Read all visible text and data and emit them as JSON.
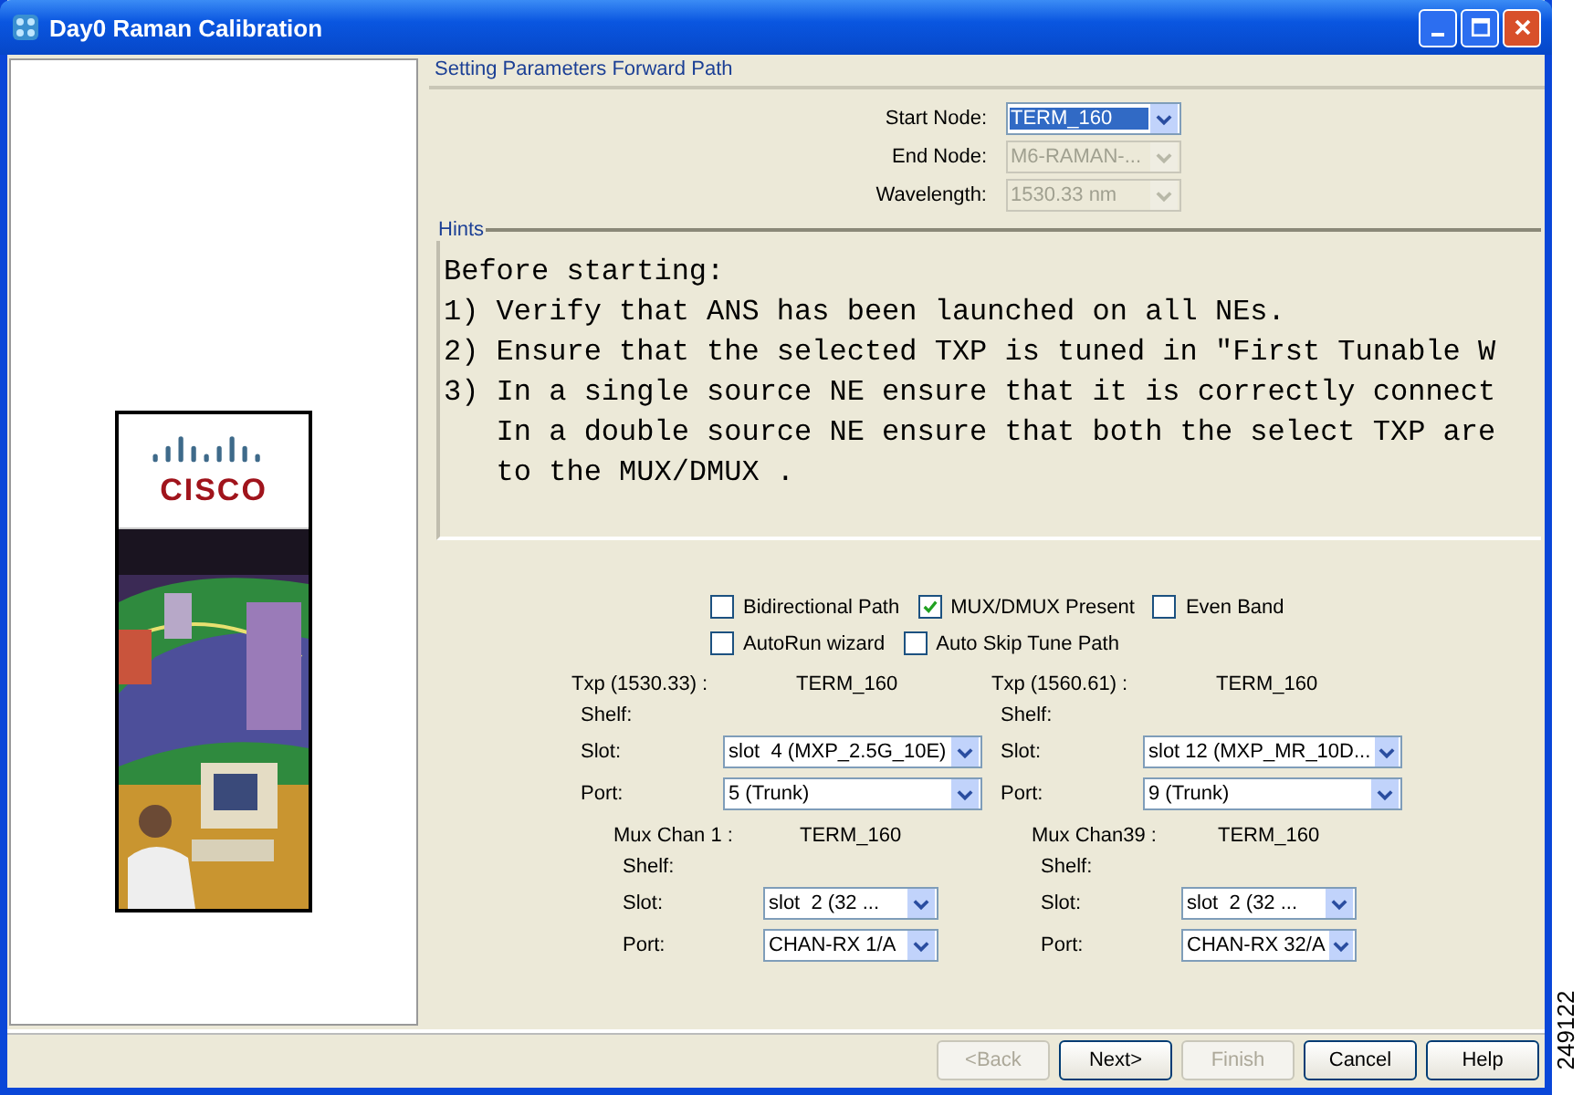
{
  "window": {
    "title": "Day0 Raman Calibration"
  },
  "logo": {
    "text": "CISCO"
  },
  "section_title": "Setting Parameters Forward Path",
  "node_fields": [
    {
      "label": "Start Node:",
      "value": "TERM_160",
      "disabled": false,
      "focused": true
    },
    {
      "label": "End Node:",
      "value": "M6-RAMAN-...",
      "disabled": true,
      "focused": false
    },
    {
      "label": "Wavelength:",
      "value": "1530.33 nm",
      "disabled": true,
      "focused": false
    }
  ],
  "hints": {
    "title": "Hints",
    "lines": [
      "Before starting:",
      "1) Verify that ANS has been launched on all NEs.",
      "2) Ensure that the selected TXP is tuned in \"First Tunable W",
      "3) In a single source NE ensure that it is correctly connect",
      "   In a double source NE ensure that both the select TXP are",
      "   to the MUX/DMUX ."
    ]
  },
  "option_rows": [
    [
      {
        "label": "Bidirectional Path",
        "checked": false
      },
      {
        "label": "MUX/DMUX Present",
        "checked": true
      },
      {
        "label": "Even Band",
        "checked": false
      }
    ],
    [
      {
        "label": "AutoRun wizard",
        "checked": false
      },
      {
        "label": "Auto Skip Tune Path",
        "checked": false
      }
    ]
  ],
  "transponders": [
    {
      "label": "Txp (1530.33) :",
      "node": "TERM_160",
      "shelf_label": "Shelf:",
      "slot_label": "Slot:",
      "slot": "slot  4 (MXP_2.5G_10E)",
      "port_label": "Port:",
      "port": "5 (Trunk)"
    },
    {
      "label": "Txp (1560.61) :",
      "node": "TERM_160",
      "shelf_label": "Shelf:",
      "slot_label": "Slot:",
      "slot": "slot 12 (MXP_MR_10D...",
      "port_label": "Port:",
      "port": "9 (Trunk)"
    }
  ],
  "mux_channels": [
    {
      "label": "Mux Chan 1 :",
      "node": "TERM_160",
      "shelf_label": "Shelf:",
      "slot_label": "Slot:",
      "slot": "slot  2 (32 ...",
      "port_label": "Port:",
      "port": "CHAN-RX 1/A"
    },
    {
      "label": "Mux Chan39 :",
      "node": "TERM_160",
      "shelf_label": "Shelf:",
      "slot_label": "Slot:",
      "slot": "slot  2 (32 ...",
      "port_label": "Port:",
      "port": "CHAN-RX 32/A"
    }
  ],
  "buttons": [
    {
      "label": "<Back",
      "disabled": true
    },
    {
      "label": "Next>",
      "disabled": false
    },
    {
      "label": "Finish",
      "disabled": true
    },
    {
      "label": "Cancel",
      "disabled": false
    },
    {
      "label": "Help",
      "disabled": false
    }
  ],
  "figure_id": "249122"
}
